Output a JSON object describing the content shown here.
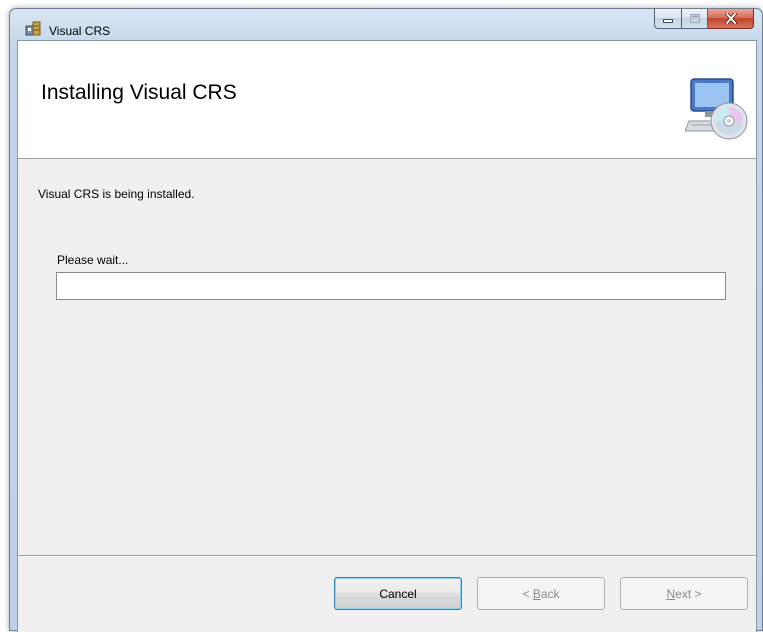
{
  "window": {
    "title": "Visual CRS",
    "icons": {
      "app": "installer-icon",
      "minimize": "minimize-icon",
      "maximize": "maximize-icon",
      "close": "close-icon"
    }
  },
  "banner": {
    "title": "Installing Visual CRS",
    "icon": "computer-cd-icon"
  },
  "body": {
    "status_text": "Visual CRS is being installed.",
    "wait_label": "Please wait...",
    "progress": 0
  },
  "buttons": {
    "cancel": "Cancel",
    "back": {
      "prefix": "< ",
      "mnemonic": "B",
      "rest": "ack"
    },
    "next": {
      "prefix": "",
      "mnemonic": "N",
      "rest": "ext >"
    }
  },
  "colors": {
    "accent_close": "#c2432c",
    "default_button_border": "#3c7fb1",
    "disabled_text": "#8a8a8a"
  }
}
